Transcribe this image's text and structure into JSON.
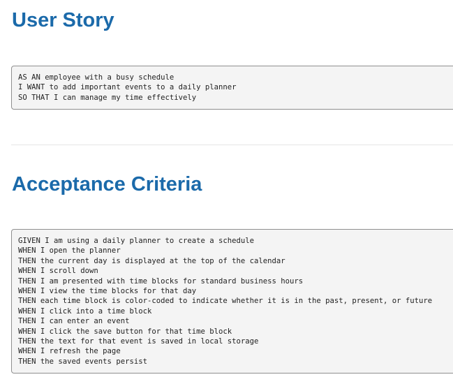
{
  "user_story": {
    "heading": "User Story",
    "lines": [
      "AS AN employee with a busy schedule",
      "I WANT to add important events to a daily planner",
      "SO THAT I can manage my time effectively"
    ]
  },
  "acceptance_criteria": {
    "heading": "Acceptance Criteria",
    "lines": [
      "GIVEN I am using a daily planner to create a schedule",
      "WHEN I open the planner",
      "THEN the current day is displayed at the top of the calendar",
      "WHEN I scroll down",
      "THEN I am presented with time blocks for standard business hours",
      "WHEN I view the time blocks for that day",
      "THEN each time block is color-coded to indicate whether it is in the past, present, or future",
      "WHEN I click into a time block",
      "THEN I can enter an event",
      "WHEN I click the save button for that time block",
      "THEN the text for that event is saved in local storage",
      "WHEN I refresh the page",
      "THEN the saved events persist"
    ]
  }
}
